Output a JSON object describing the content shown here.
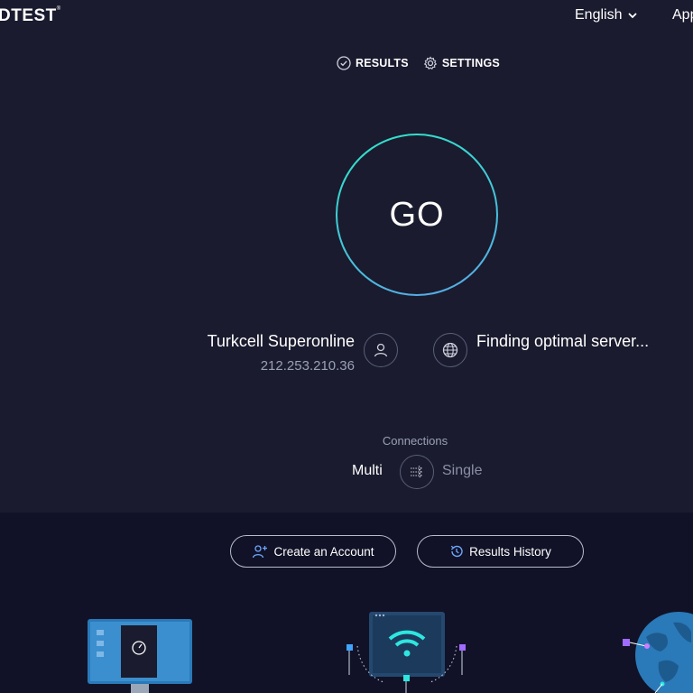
{
  "header": {
    "logo": "DTEST",
    "language": "English",
    "apps": "Apps"
  },
  "tabs": [
    {
      "label": "RESULTS"
    },
    {
      "label": "SETTINGS"
    }
  ],
  "go_label": "GO",
  "isp": {
    "name": "Turkcell Superonline",
    "ip": "212.253.210.36"
  },
  "server": {
    "status": "Finding optimal server..."
  },
  "connections": {
    "label": "Connections",
    "multi": "Multi",
    "single": "Single",
    "selected": "Multi"
  },
  "actions": {
    "create_account": "Create an Account",
    "results_history": "Results History"
  },
  "colors": {
    "accent_start": "#2ee6c8",
    "accent_end": "#5aa7e8",
    "background": "#1a1b2e",
    "lower_background": "#111227"
  }
}
